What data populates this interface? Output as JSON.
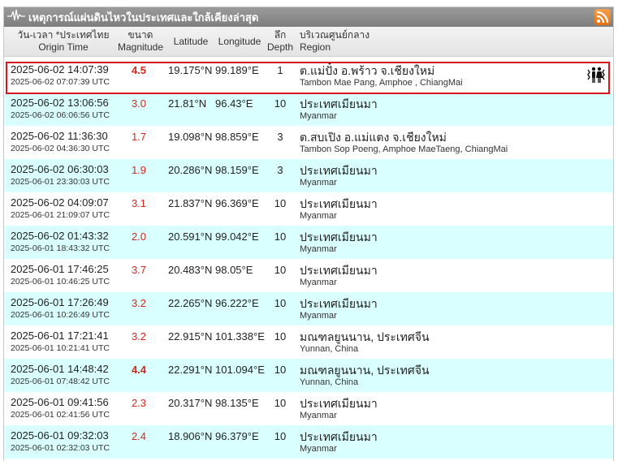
{
  "panel": {
    "title": "เหตุการณ์แผ่นดินไหวในประเทศและใกล้เคียงล่าสุด",
    "icons": {
      "title": "seismograph-icon",
      "feed": "rss-icon",
      "felt": "people-felt-icon"
    }
  },
  "columns": {
    "time_th": "วัน-เวลา *ประเทศไทย",
    "time_en": "Origin Time",
    "mag_th": "ขนาด",
    "mag_en": "Magnitude",
    "lat": "Latitude",
    "lon": "Longitude",
    "depth_th": "ลึก",
    "depth_en": "Depth",
    "region_th": "บริเวณศูนย์กลาง",
    "region_en": "Region"
  },
  "quakes": [
    {
      "time": "2025-06-02 14:07:39",
      "utc": "2025-06-02 07:07:39 UTC",
      "mag": "4.5",
      "lat": "19.175°N",
      "lon": "99.189°E",
      "depth": "1",
      "region": "ต.แม่ปั๋ง อ.พร้าว จ.เชียงใหม่",
      "region_en": "Tambon Mae Pang, Amphoe , ChiangMai"
    },
    {
      "time": "2025-06-02 13:06:56",
      "utc": "2025-06-02 06:06:56 UTC",
      "mag": "3.0",
      "lat": "21.81°N",
      "lon": "96.43°E",
      "depth": "10",
      "region": "ประเทศเมียนมา",
      "region_en": "Myanmar"
    },
    {
      "time": "2025-06-02 11:36:30",
      "utc": "2025-06-02 04:36:30 UTC",
      "mag": "1.7",
      "lat": "19.098°N",
      "lon": "98.859°E",
      "depth": "3",
      "region": "ต.สบเปิง อ.แม่แตง จ.เชียงใหม่",
      "region_en": "Tambon Sop Poeng, Amphoe MaeTaeng, ChiangMai"
    },
    {
      "time": "2025-06-02 06:30:03",
      "utc": "2025-06-01 23:30:03 UTC",
      "mag": "1.9",
      "lat": "20.286°N",
      "lon": "98.159°E",
      "depth": "3",
      "region": "ประเทศเมียนมา",
      "region_en": "Myanmar"
    },
    {
      "time": "2025-06-02 04:09:07",
      "utc": "2025-06-01 21:09:07 UTC",
      "mag": "3.1",
      "lat": "21.837°N",
      "lon": "96.369°E",
      "depth": "10",
      "region": "ประเทศเมียนมา",
      "region_en": "Myanmar"
    },
    {
      "time": "2025-06-02 01:43:32",
      "utc": "2025-06-01 18:43:32 UTC",
      "mag": "2.0",
      "lat": "20.591°N",
      "lon": "99.042°E",
      "depth": "10",
      "region": "ประเทศเมียนมา",
      "region_en": "Myanmar"
    },
    {
      "time": "2025-06-01 17:46:25",
      "utc": "2025-06-01 10:46:25 UTC",
      "mag": "3.7",
      "lat": "20.483°N",
      "lon": "98.05°E",
      "depth": "10",
      "region": "ประเทศเมียนมา",
      "region_en": "Myanmar"
    },
    {
      "time": "2025-06-01 17:26:49",
      "utc": "2025-06-01 10:26:49 UTC",
      "mag": "3.2",
      "lat": "22.265°N",
      "lon": "96.222°E",
      "depth": "10",
      "region": "ประเทศเมียนมา",
      "region_en": "Myanmar"
    },
    {
      "time": "2025-06-01 17:21:41",
      "utc": "2025-06-01 10:21:41 UTC",
      "mag": "3.2",
      "lat": "22.915°N",
      "lon": "101.338°E",
      "depth": "10",
      "region": "มณฑลยูนนาน, ประเทศจีน",
      "region_en": "Yunnan, China"
    },
    {
      "time": "2025-06-01 14:48:42",
      "utc": "2025-06-01 07:48:42 UTC",
      "mag": "4.4",
      "lat": "22.291°N",
      "lon": "101.094°E",
      "depth": "10",
      "region": "มณฑลยูนนาน, ประเทศจีน",
      "region_en": "Yunnan, China"
    },
    {
      "time": "2025-06-01 09:41:56",
      "utc": "2025-06-01 02:41:56 UTC",
      "mag": "2.3",
      "lat": "20.317°N",
      "lon": "98.135°E",
      "depth": "10",
      "region": "ประเทศเมียนมา",
      "region_en": "Myanmar"
    },
    {
      "time": "2025-06-01 09:32:03",
      "utc": "2025-06-01 02:32:03 UTC",
      "mag": "2.4",
      "lat": "18.906°N",
      "lon": "96.379°E",
      "depth": "10",
      "region": "ประเทศเมียนมา",
      "region_en": "Myanmar"
    }
  ],
  "colors": {
    "alt_row": "#d9ffff",
    "magnitude": "#d0281e",
    "highlight": "#d7191f",
    "titlebar": "#8a8a8a"
  }
}
